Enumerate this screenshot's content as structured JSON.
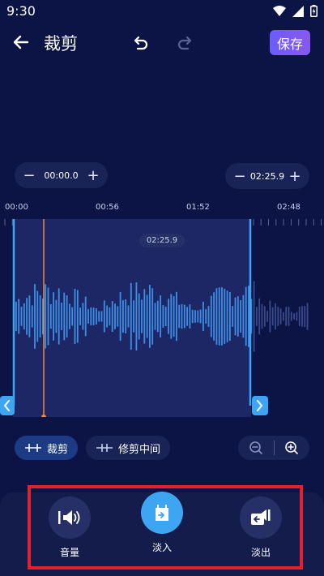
{
  "status_bar": {
    "time": "9:30"
  },
  "header": {
    "title": "裁剪",
    "save_label": "保存"
  },
  "trim": {
    "start_time": "00:00.0",
    "end_time": "02:25.9",
    "playhead_time": "02:25.9",
    "decrease_symbol": "−",
    "increase_symbol": "+"
  },
  "ruler": {
    "labels": [
      "00:00",
      "00:56",
      "01:52",
      "02:48"
    ]
  },
  "modes": {
    "trim_label": "裁剪",
    "trim_middle_label": "修剪中间"
  },
  "tools": [
    {
      "label": "音量",
      "icon": "volume-icon"
    },
    {
      "label": "淡入",
      "icon": "fade-in-icon"
    },
    {
      "label": "淡出",
      "icon": "fade-out-icon"
    }
  ],
  "colors": {
    "background": "#0b1445",
    "accent_blue": "#3da5f2",
    "playhead_orange": "#f28a3a",
    "save_button": "#7a5af5",
    "highlight_red": "#e3202b"
  }
}
